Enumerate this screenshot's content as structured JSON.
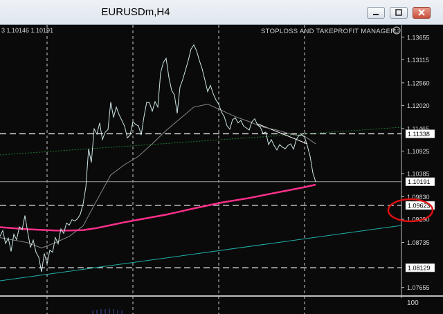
{
  "window": {
    "title": "EURUSDm,H4"
  },
  "chart": {
    "ohlc_text": "3 1.10146 1.10191",
    "ea_label": "STOPLOSS AND TAKEPROFIT MANAGER",
    "indicator_scale": "100",
    "colors": {
      "background": "#0a0a0a",
      "price_line": "#cfe6e6",
      "ma_slow": "#8a8a8a",
      "ma_pink": "#ff2f8a",
      "trend_teal": "#20b0a8",
      "trend_dotted": "#1f7a2e",
      "highlight_circle": "#e01010"
    }
  },
  "chart_data": {
    "type": "line",
    "symbol": "EURUSDm",
    "timeframe": "H4",
    "ylim": [
      1.0745,
      1.1395
    ],
    "y_ticks": [
      "1.13655",
      "1.13115",
      "1.12560",
      "1.12020",
      "1.11465",
      "1.10925",
      "1.10385",
      "1.09830",
      "1.09290",
      "1.08735",
      "1.07655"
    ],
    "horizontal_levels": [
      {
        "label": "1.11338",
        "value": 1.11338
      },
      {
        "label": "1.10191",
        "value": 1.10191
      },
      {
        "label": "1.09623",
        "value": 1.09623
      },
      {
        "label": "1.08129",
        "value": 1.08129
      }
    ],
    "series": [
      {
        "x": [
          0,
          4,
          8,
          12,
          16,
          20,
          24,
          28,
          32,
          36,
          40,
          44,
          48,
          52,
          56,
          60,
          64,
          68,
          72,
          76,
          80,
          84,
          88,
          92,
          96,
          100,
          104,
          108,
          112,
          116,
          120,
          124,
          128,
          132,
          136,
          140,
          144,
          148,
          152,
          156,
          160,
          164,
          168,
          172,
          176,
          180,
          184,
          188,
          192,
          196,
          200,
          204,
          208,
          212,
          216,
          220,
          224,
          228,
          232,
          236,
          240,
          244,
          248,
          252,
          256,
          260,
          264,
          268,
          272,
          276,
          280,
          284,
          288,
          292,
          296,
          300,
          304,
          308,
          312,
          316,
          320,
          324,
          328,
          332,
          336,
          340,
          344,
          348,
          352,
          356,
          360,
          364,
          368,
          372,
          376,
          380,
          384,
          388,
          392,
          396,
          400,
          404,
          408,
          412,
          416,
          420,
          424,
          428,
          432,
          436,
          440,
          444,
          448,
          452,
          456
        ],
        "values": [
          1.0888,
          1.0902,
          1.0871,
          1.0884,
          1.0852,
          1.0893,
          1.088,
          1.0911,
          1.0904,
          1.0938,
          1.0898,
          1.0862,
          1.0879,
          1.085,
          1.0838,
          1.0803,
          1.0847,
          1.0822,
          1.0855,
          1.085,
          1.0885,
          1.087,
          1.0906,
          1.0895,
          1.092,
          1.0915,
          1.0928,
          1.0925,
          1.093,
          1.0941,
          1.0965,
          1.1006,
          1.1098,
          1.1065,
          1.1146,
          1.1133,
          1.116,
          1.112,
          1.1138,
          1.1144,
          1.121,
          1.1173,
          1.1198,
          1.118,
          1.1166,
          1.1152,
          1.1124,
          1.1131,
          1.1163,
          1.1156,
          1.1153,
          1.1131,
          1.1175,
          1.121,
          1.1208,
          1.1188,
          1.1211,
          1.1198,
          1.128,
          1.1305,
          1.1315,
          1.1269,
          1.1238,
          1.1227,
          1.1183,
          1.1246,
          1.1264,
          1.1287,
          1.131,
          1.1337,
          1.1347,
          1.1333,
          1.131,
          1.129,
          1.1263,
          1.1235,
          1.125,
          1.123,
          1.1215,
          1.1205,
          1.1186,
          1.1175,
          1.1153,
          1.1145,
          1.1168,
          1.1172,
          1.116,
          1.1166,
          1.1152,
          1.1148,
          1.1143,
          1.1163,
          1.117,
          1.1155,
          1.115,
          1.1135,
          1.1138,
          1.1108,
          1.112,
          1.1106,
          1.1095,
          1.1108,
          1.1102,
          1.1098,
          1.1106,
          1.111,
          1.1097,
          1.112,
          1.113,
          1.1132,
          1.1126,
          1.1105,
          1.108,
          1.104,
          1.1019
        ]
      },
      {
        "x": [
          0,
          40,
          60,
          80,
          100,
          120,
          140,
          160,
          180,
          200,
          220,
          240,
          260,
          280,
          300,
          320,
          340,
          360,
          380,
          400,
          420,
          440,
          456
        ],
        "values": [
          1.0885,
          1.0873,
          1.086,
          1.0873,
          1.0888,
          1.0913,
          1.0975,
          1.1035,
          1.106,
          1.108,
          1.111,
          1.1142,
          1.117,
          1.1198,
          1.1205,
          1.119,
          1.1175,
          1.1163,
          1.115,
          1.1143,
          1.1133,
          1.1128,
          1.111
        ]
      },
      {
        "x": [
          0,
          40,
          80,
          100,
          120,
          140,
          160,
          180,
          200,
          240,
          280,
          320,
          360,
          400,
          440,
          456
        ],
        "values": [
          1.091,
          1.0905,
          1.0902,
          1.0902,
          1.0903,
          1.0908,
          1.0915,
          1.0922,
          1.0928,
          1.094,
          1.0955,
          1.0969,
          1.098,
          1.0993,
          1.1006,
          1.1012
        ]
      }
    ]
  }
}
